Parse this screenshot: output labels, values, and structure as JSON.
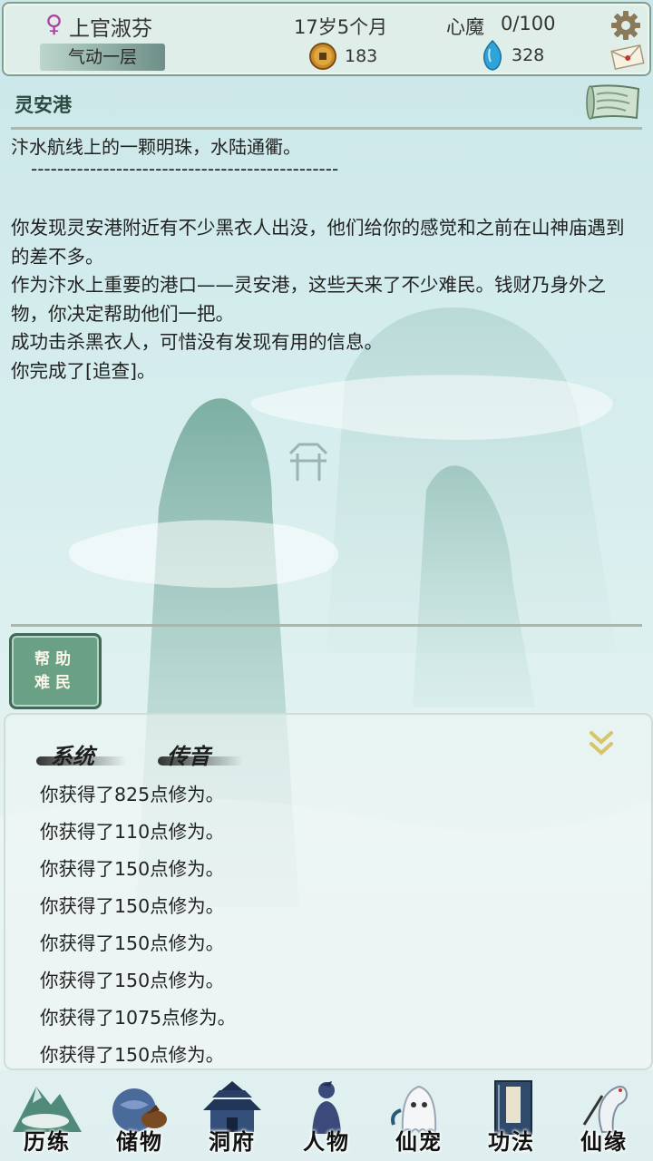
{
  "header": {
    "gender_symbol": "♀",
    "player_name": "上官淑芬",
    "realm": "气动一层",
    "age": "17岁5个月",
    "demon_label": "心魔",
    "demon_value": "0/100",
    "copper_coins": "183",
    "spirit_stones": "328"
  },
  "location": {
    "name": "灵安港",
    "description": "汴水航线上的一颗明珠，水陆通衢。",
    "divider": "-----------------------------------------------",
    "story": [
      "你发现灵安港附近有不少黑衣人出没，他们给你的感觉和之前在山神庙遇到的差不多。",
      "作为汴水上重要的港口——灵安港，这些天来了不少难民。钱财乃身外之物，你决定帮助他们一把。",
      "成功击杀黑衣人，可惜没有发现有用的信息。",
      "你完成了[追查]。"
    ]
  },
  "action": {
    "line1": "帮助",
    "line2": "难民"
  },
  "log": {
    "tab_system": "系统",
    "tab_voice": "传音",
    "entries": [
      "你获得了825点修为。",
      "你获得了110点修为。",
      "你获得了150点修为。",
      "你获得了150点修为。",
      "你获得了150点修为。",
      "你获得了150点修为。",
      "你获得了1075点修为。",
      "你获得了150点修为。"
    ]
  },
  "nav": [
    {
      "label": "历练",
      "icon": "mountain-cloud-icon"
    },
    {
      "label": "储物",
      "icon": "treasure-bag-icon"
    },
    {
      "label": "洞府",
      "icon": "pagoda-icon"
    },
    {
      "label": "人物",
      "icon": "person-silhouette-icon"
    },
    {
      "label": "仙宠",
      "icon": "ghost-pet-icon"
    },
    {
      "label": "功法",
      "icon": "scripture-book-icon"
    },
    {
      "label": "仙缘",
      "icon": "crane-icon"
    }
  ],
  "colors": {
    "accent_green": "#6aa186",
    "header_border": "#7f9f8f",
    "gender_pink": "#b040a0",
    "gem_blue": "#2fa4d8"
  }
}
